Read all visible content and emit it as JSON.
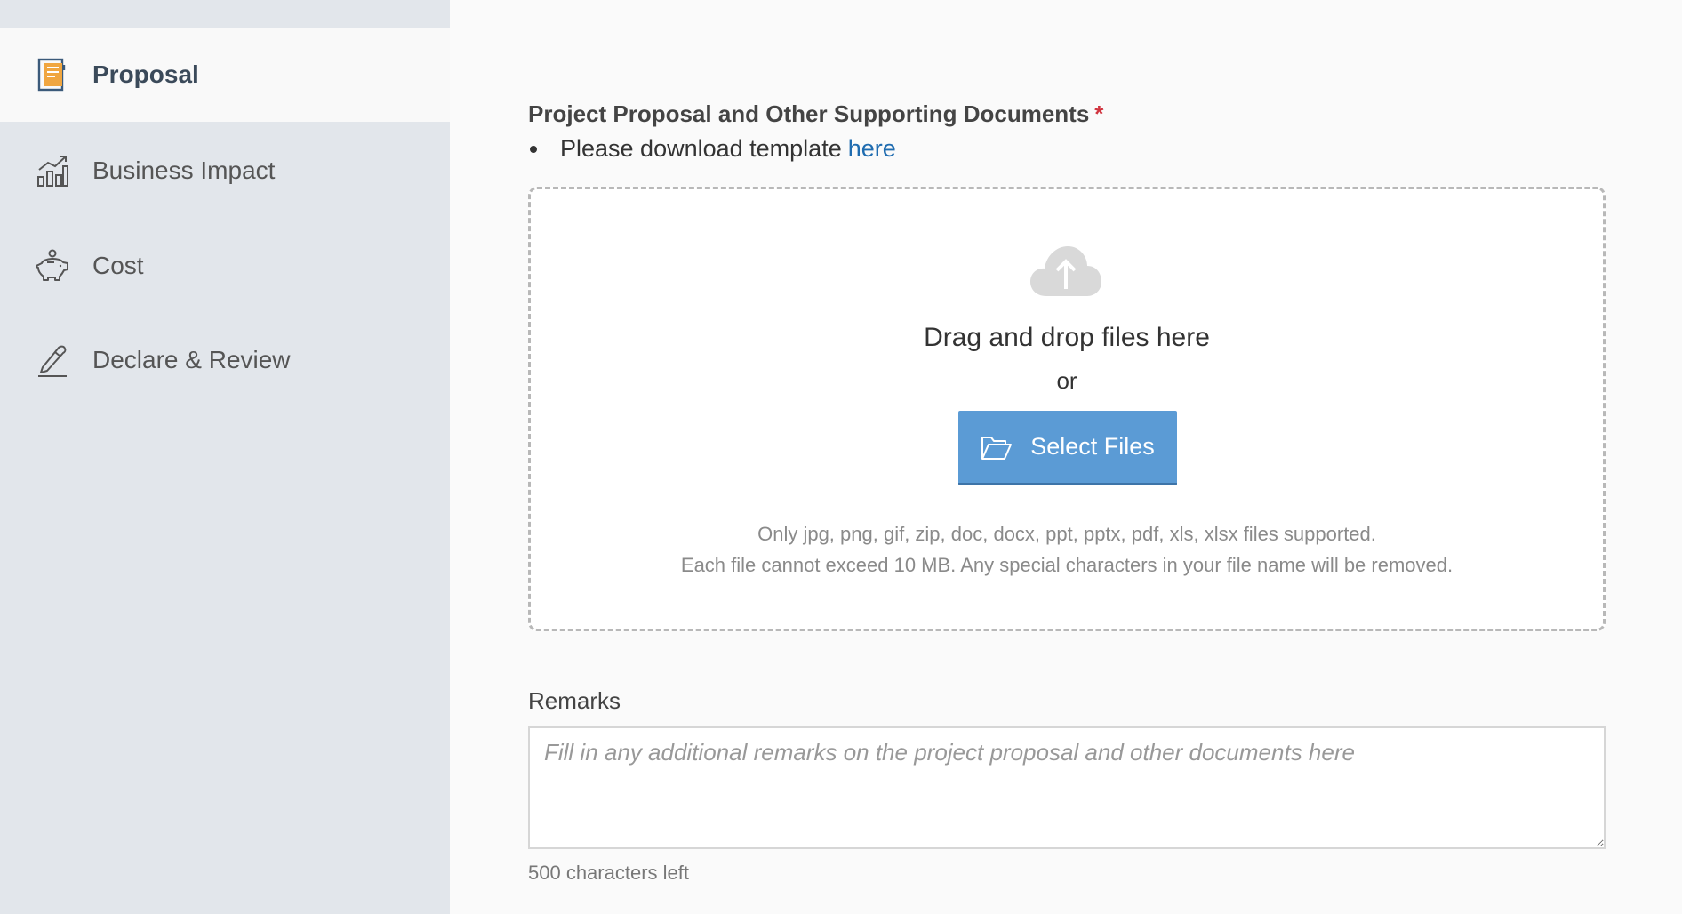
{
  "sidebar": {
    "items": [
      {
        "label": "Proposal",
        "icon": "document-icon",
        "active": true
      },
      {
        "label": "Business Impact",
        "icon": "bar-chart-icon",
        "active": false
      },
      {
        "label": "Cost",
        "icon": "piggy-bank-icon",
        "active": false
      },
      {
        "label": "Declare & Review",
        "icon": "pen-icon",
        "active": false
      }
    ]
  },
  "upload": {
    "label": "Project Proposal and Other Supporting Documents",
    "required_mark": "*",
    "template_text": "Please download template",
    "template_link": "here",
    "drop_title": "Drag and drop files here",
    "or_text": "or",
    "button_label": "Select Files",
    "hint_types": "Only jpg, png, gif, zip, doc, docx, ppt, pptx, pdf, xls, xlsx files supported.",
    "hint_size": "Each file cannot exceed 10 MB. Any special characters in your file name will be removed."
  },
  "remarks": {
    "label": "Remarks",
    "value": "",
    "placeholder": "Fill in any additional remarks on the project proposal and other documents here",
    "chars_left": "500 characters left"
  },
  "colors": {
    "accent": "#5b9bd5",
    "link": "#1f6cb0",
    "required": "#d0343f",
    "sidebar_bg": "#e2e6eb"
  }
}
